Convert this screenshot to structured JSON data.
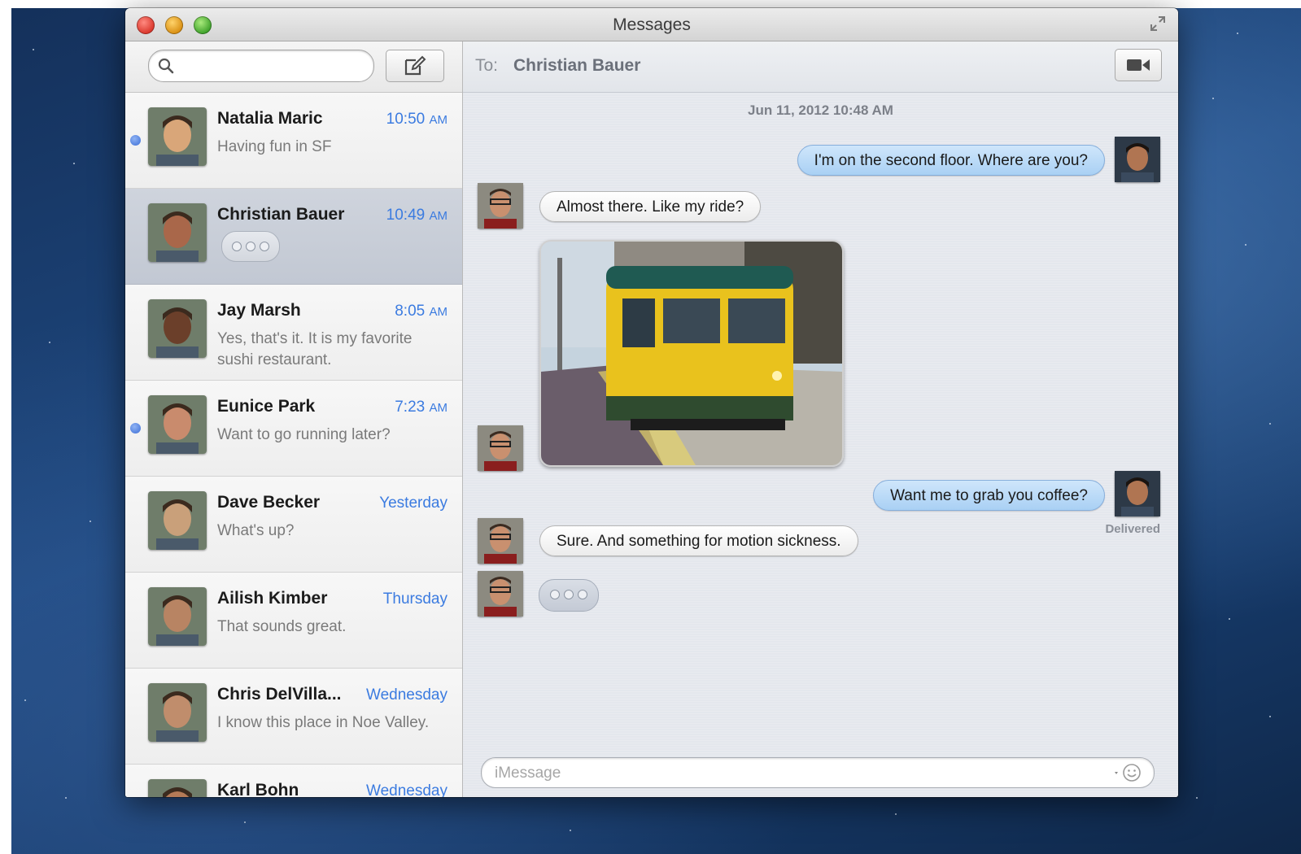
{
  "window": {
    "title": "Messages"
  },
  "sidebar": {
    "search": {
      "placeholder": "",
      "value": ""
    },
    "conversations": [
      {
        "name": "Natalia Maric",
        "time": "10:50",
        "ampm": "AM",
        "preview": "Having fun in SF",
        "unread": true,
        "selected": false,
        "avatar_color": "#d9a679"
      },
      {
        "name": "Christian Bauer",
        "time": "10:49",
        "ampm": "AM",
        "preview": "",
        "typing": true,
        "unread": false,
        "selected": true,
        "avatar_color": "#a9674a"
      },
      {
        "name": "Jay Marsh",
        "time": "8:05",
        "ampm": "AM",
        "preview": "Yes, that's it. It is my favorite sushi restaurant.",
        "unread": false,
        "selected": false,
        "avatar_color": "#6b3f2a"
      },
      {
        "name": "Eunice Park",
        "time": "7:23",
        "ampm": "AM",
        "preview": "Want to go running later?",
        "unread": true,
        "selected": false,
        "avatar_color": "#c98b6d"
      },
      {
        "name": "Dave Becker",
        "time": "Yesterday",
        "ampm": "",
        "preview": "What's up?",
        "unread": false,
        "selected": false,
        "avatar_color": "#c9a07a"
      },
      {
        "name": "Ailish Kimber",
        "time": "Thursday",
        "ampm": "",
        "preview": "That sounds great.",
        "unread": false,
        "selected": false,
        "avatar_color": "#b88463"
      },
      {
        "name": "Chris DelVilla...",
        "time": "Wednesday",
        "ampm": "",
        "preview": "I know this place in Noe Valley.",
        "unread": false,
        "selected": false,
        "avatar_color": "#c08d6c"
      },
      {
        "name": "Karl Bohn",
        "time": "Wednesday",
        "ampm": "",
        "preview": "",
        "unread": false,
        "selected": false,
        "avatar_color": "#b47a57"
      }
    ]
  },
  "chat": {
    "to_label": "To:",
    "recipient": "Christian Bauer",
    "timestamp": "Jun 11, 2012 10:48 AM",
    "messages": [
      {
        "direction": "out",
        "text": "I'm on the second floor. Where are you?"
      },
      {
        "direction": "in",
        "text": "Almost there. Like my ride?"
      },
      {
        "direction": "in",
        "type": "photo",
        "text": ""
      },
      {
        "direction": "out",
        "text": "Want me to grab you coffee?"
      },
      {
        "direction": "in",
        "text": "Sure. And something for motion sickness."
      }
    ],
    "delivered": "Delivered",
    "compose_placeholder": "iMessage"
  },
  "colors": {
    "accent": "#3b7be0",
    "unread_dot": "#3c6ed6",
    "outgoing_bubble": "#a9d0f4"
  }
}
